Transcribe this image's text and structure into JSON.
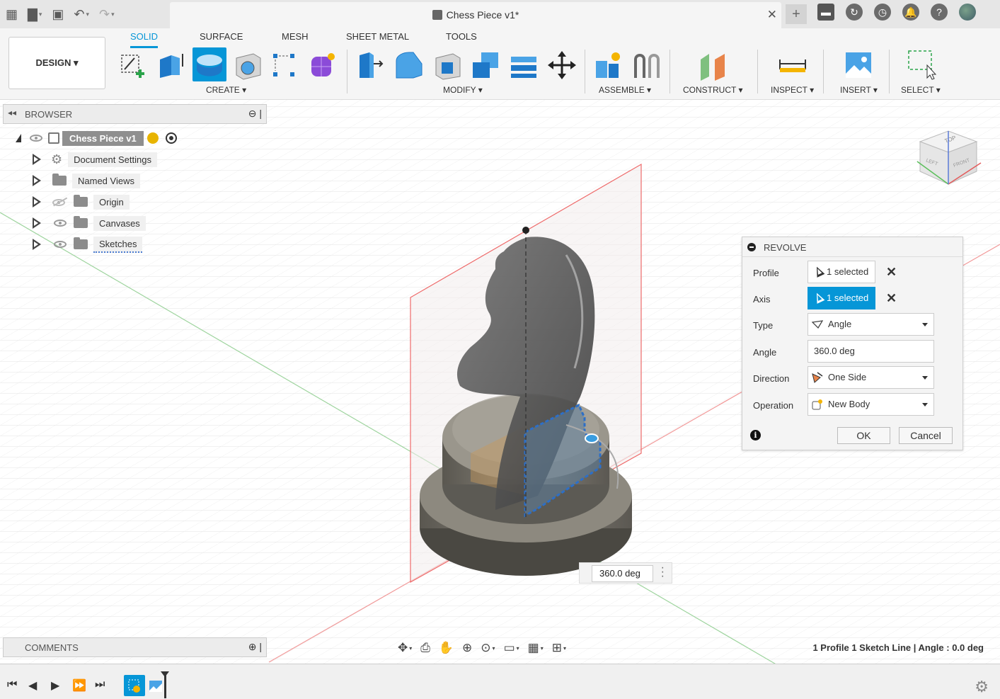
{
  "titlebar": {
    "doc_title": "Chess Piece v1*",
    "icons": [
      "grid-icon",
      "file-icon",
      "save-icon",
      "undo-icon",
      "redo-icon"
    ],
    "right_icons": [
      "plus-icon",
      "notifications-icon",
      "recent-icon",
      "jobs-icon",
      "alerts-icon",
      "help-icon",
      "avatar"
    ]
  },
  "ribbon": {
    "workspace": "DESIGN",
    "tabs": [
      "SOLID",
      "SURFACE",
      "MESH",
      "SHEET METAL",
      "TOOLS"
    ],
    "active_tab": "SOLID",
    "groups": [
      "CREATE",
      "MODIFY",
      "ASSEMBLE",
      "CONSTRUCT",
      "INSPECT",
      "INSERT",
      "SELECT"
    ]
  },
  "browser": {
    "title": "BROWSER",
    "root": "Chess Piece v1",
    "items": [
      "Document Settings",
      "Named Views",
      "Origin",
      "Canvases",
      "Sketches"
    ]
  },
  "comments": {
    "title": "COMMENTS"
  },
  "revolve": {
    "title": "REVOLVE",
    "profile_label": "Profile",
    "profile_value": "1 selected",
    "axis_label": "Axis",
    "axis_value": "1 selected",
    "type_label": "Type",
    "type_value": "Angle",
    "angle_label": "Angle",
    "angle_value": "360.0 deg",
    "direction_label": "Direction",
    "direction_value": "One Side",
    "operation_label": "Operation",
    "operation_value": "New Body",
    "ok": "OK",
    "cancel": "Cancel"
  },
  "canvas": {
    "angle_input": "360.0 deg",
    "status": "1 Profile 1 Sketch Line | Angle : 0.0 deg",
    "viewcube": {
      "top": "TOP",
      "left": "LEFT",
      "front": "FRONT"
    }
  },
  "colors": {
    "accent": "#0696d7",
    "ribbon_bg": "#f5f5f5",
    "titlebar_bg": "#e6e6e6"
  }
}
